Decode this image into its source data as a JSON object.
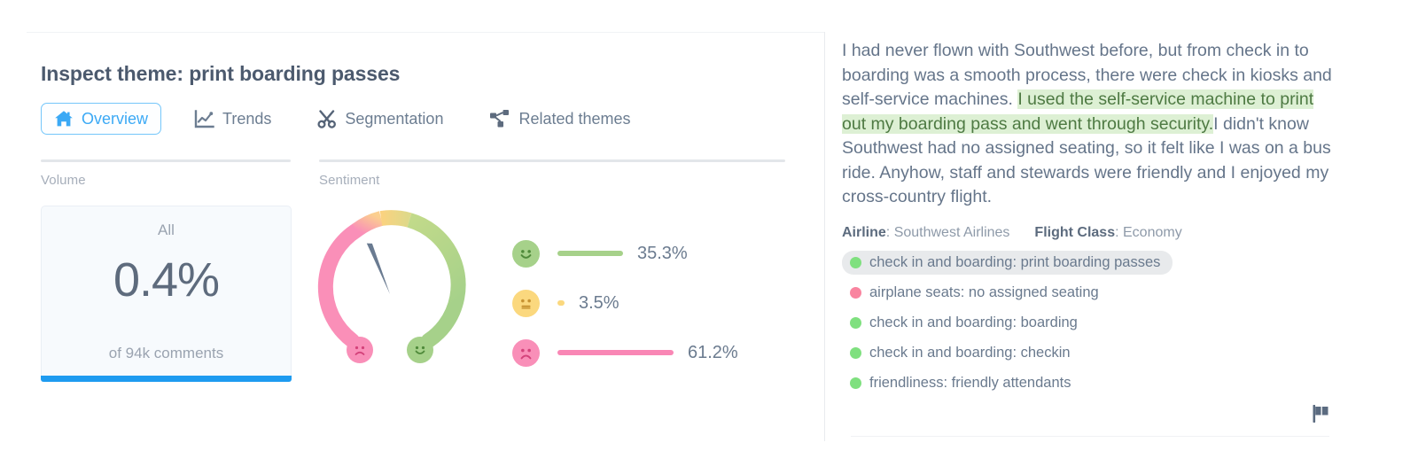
{
  "header": {
    "title": "Inspect theme: print boarding passes"
  },
  "tabs": [
    {
      "label": "Overview",
      "icon": "home-icon",
      "active": true
    },
    {
      "label": "Trends",
      "icon": "line-chart-icon",
      "active": false
    },
    {
      "label": "Segmentation",
      "icon": "scissors-icon",
      "active": false
    },
    {
      "label": "Related themes",
      "icon": "sitemap-icon",
      "active": false
    }
  ],
  "volume": {
    "section_label": "Volume",
    "scope": "All",
    "value": "0.4%",
    "subtext": "of 94k comments",
    "accent_color": "#1e9bf0"
  },
  "sentiment": {
    "section_label": "Sentiment",
    "gauge": {
      "needle_angle_deg": -22,
      "negative_color": "#f98fb8",
      "neutral_color": "#fbd87e",
      "positive_color": "#a6d18a",
      "negative_emoji": "frowning-face",
      "positive_emoji": "smiling-face"
    },
    "breakdown": [
      {
        "emoji": "smiling-face",
        "label_color": "#a6d18a",
        "value": "35.3%",
        "pct": 35.3
      },
      {
        "emoji": "neutral-face",
        "label_color": "#fbd87e",
        "value": "3.5%",
        "pct": 3.5
      },
      {
        "emoji": "frowning-face",
        "label_color": "#f98fb8",
        "value": "61.2%",
        "pct": 61.2
      }
    ]
  },
  "review": {
    "text_before": "I had never flown with Southwest before, but from check in to boarding was a smooth process, there were check in kiosks and self-service machines. ",
    "highlight": "I used the self-service machine to print out my boarding pass and went through security.",
    "text_after": "I didn't know Southwest had no assigned seating, so it felt like I was on a bus ride. Anyhow, staff and stewards were friendly and I enjoyed my cross-country flight.",
    "highlight_color": "#ddf0d4",
    "meta": [
      {
        "key": "Airline",
        "value": "Southwest Airlines"
      },
      {
        "key": "Flight Class",
        "value": "Economy"
      }
    ],
    "themes": [
      {
        "label": "check in and boarding: print boarding passes",
        "dot_color": "#7fe07f",
        "selected": true
      },
      {
        "label": "airplane seats: no assigned seating",
        "dot_color": "#f9849f",
        "selected": false
      },
      {
        "label": "check in and boarding: boarding",
        "dot_color": "#7fe07f",
        "selected": false
      },
      {
        "label": "check in and boarding: checkin",
        "dot_color": "#7fe07f",
        "selected": false
      },
      {
        "label": "friendliness: friendly attendants",
        "dot_color": "#7fe07f",
        "selected": false
      }
    ],
    "flag_icon": "flag-icon"
  }
}
